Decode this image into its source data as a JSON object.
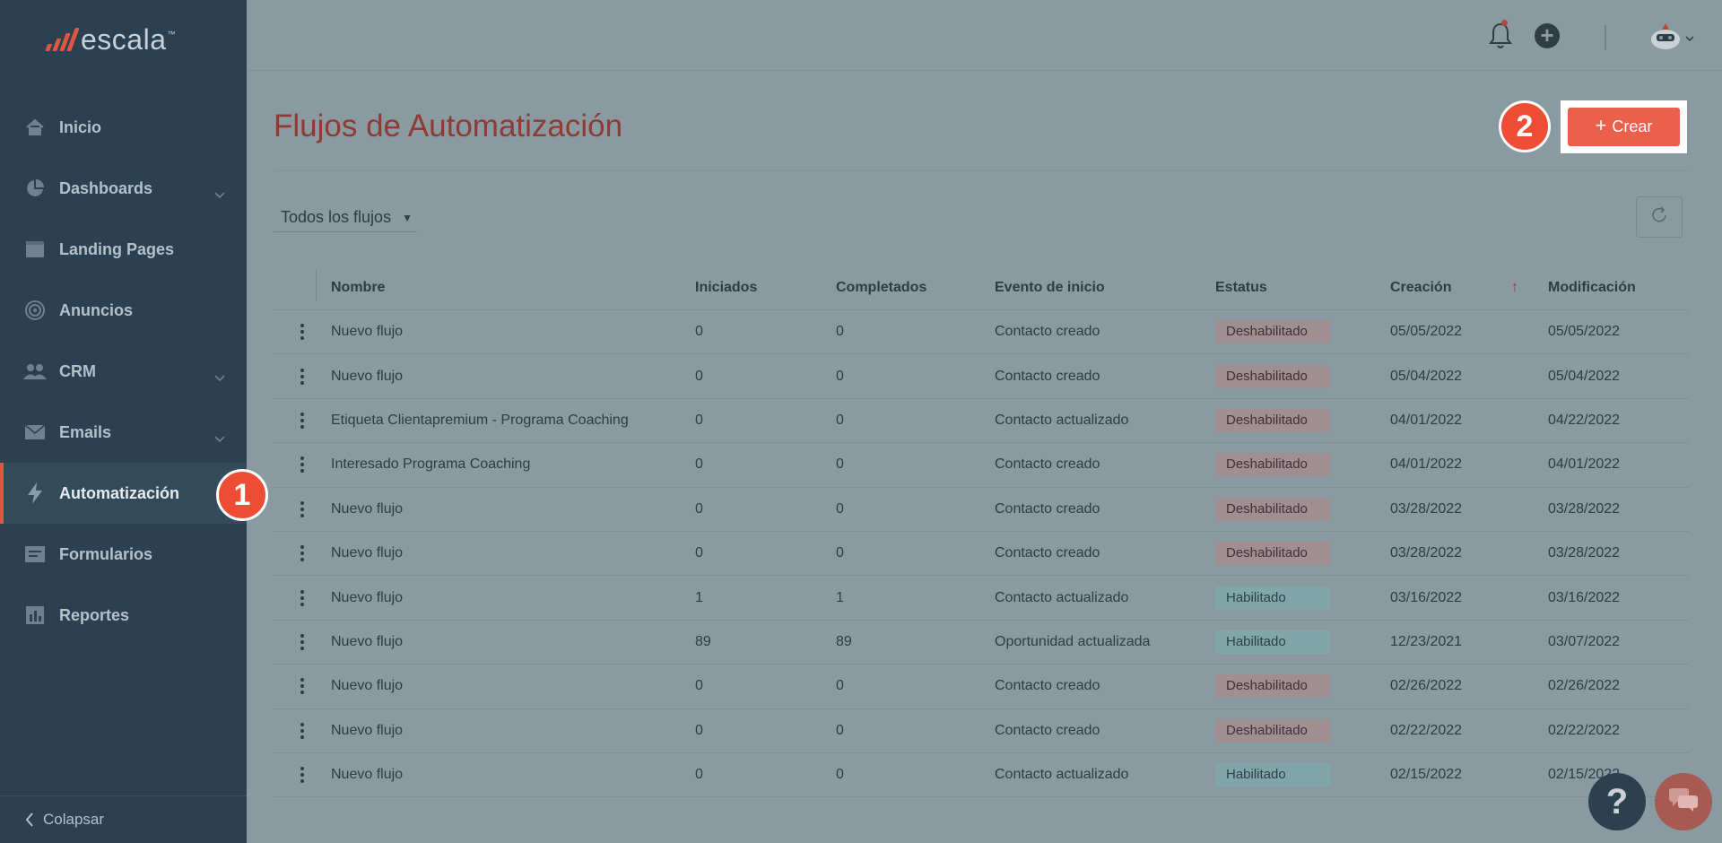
{
  "app": {
    "logo_text": "escala",
    "logo_tm": "™"
  },
  "colors": {
    "accent": "#ec5f4c",
    "sidebar": "#2b4050",
    "overlay": "#8a9aa1"
  },
  "sidebar": {
    "items": [
      {
        "label": "Inicio",
        "icon": "home-icon"
      },
      {
        "label": "Dashboards",
        "icon": "pie-chart-icon",
        "has_chevron": true
      },
      {
        "label": "Landing Pages",
        "icon": "browser-icon"
      },
      {
        "label": "Anuncios",
        "icon": "target-icon"
      },
      {
        "label": "CRM",
        "icon": "users-icon",
        "has_chevron": true
      },
      {
        "label": "Emails",
        "icon": "envelope-icon",
        "has_chevron": true
      },
      {
        "label": "Automatización",
        "icon": "lightning-icon",
        "active": true
      },
      {
        "label": "Formularios",
        "icon": "form-icon"
      },
      {
        "label": "Reportes",
        "icon": "bar-chart-icon"
      }
    ],
    "collapse_label": "Colapsar"
  },
  "header": {
    "title": "Flujos de Automatización",
    "create_label": "Crear"
  },
  "steps": {
    "one": "1",
    "two": "2"
  },
  "filter": {
    "label": "Todos los flujos"
  },
  "table": {
    "columns": [
      "Nombre",
      "Iniciados",
      "Completados",
      "Evento de inicio",
      "Estatus",
      "Creación",
      "Modificación"
    ],
    "rows": [
      {
        "name": "Nuevo flujo",
        "started": "0",
        "completed": "0",
        "event": "Contacto creado",
        "status": "Deshabilitado",
        "created": "05/05/2022",
        "modified": "05/05/2022"
      },
      {
        "name": "Nuevo flujo",
        "started": "0",
        "completed": "0",
        "event": "Contacto creado",
        "status": "Deshabilitado",
        "created": "05/04/2022",
        "modified": "05/04/2022"
      },
      {
        "name": "Etiqueta Clientapremium - Programa Coaching",
        "started": "0",
        "completed": "0",
        "event": "Contacto actualizado",
        "status": "Deshabilitado",
        "created": "04/01/2022",
        "modified": "04/22/2022"
      },
      {
        "name": "Interesado Programa Coaching",
        "started": "0",
        "completed": "0",
        "event": "Contacto creado",
        "status": "Deshabilitado",
        "created": "04/01/2022",
        "modified": "04/01/2022"
      },
      {
        "name": "Nuevo flujo",
        "started": "0",
        "completed": "0",
        "event": "Contacto creado",
        "status": "Deshabilitado",
        "created": "03/28/2022",
        "modified": "03/28/2022"
      },
      {
        "name": "Nuevo flujo",
        "started": "0",
        "completed": "0",
        "event": "Contacto creado",
        "status": "Deshabilitado",
        "created": "03/28/2022",
        "modified": "03/28/2022"
      },
      {
        "name": "Nuevo flujo",
        "started": "1",
        "completed": "1",
        "event": "Contacto actualizado",
        "status": "Habilitado",
        "created": "03/16/2022",
        "modified": "03/16/2022"
      },
      {
        "name": "Nuevo flujo",
        "started": "89",
        "completed": "89",
        "event": "Oportunidad actualizada",
        "status": "Habilitado",
        "created": "12/23/2021",
        "modified": "03/07/2022"
      },
      {
        "name": "Nuevo flujo",
        "started": "0",
        "completed": "0",
        "event": "Contacto creado",
        "status": "Deshabilitado",
        "created": "02/26/2022",
        "modified": "02/26/2022"
      },
      {
        "name": "Nuevo flujo",
        "started": "0",
        "completed": "0",
        "event": "Contacto creado",
        "status": "Deshabilitado",
        "created": "02/22/2022",
        "modified": "02/22/2022"
      },
      {
        "name": "Nuevo flujo",
        "started": "0",
        "completed": "0",
        "event": "Contacto actualizado",
        "status": "Habilitado",
        "created": "02/15/2022",
        "modified": "02/15/2022"
      }
    ]
  },
  "help": {
    "label": "?"
  }
}
